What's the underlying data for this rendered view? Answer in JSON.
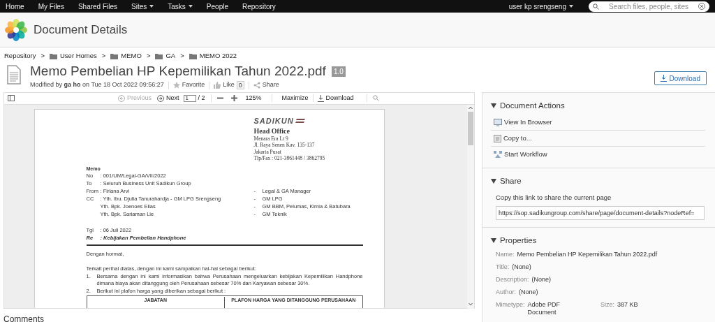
{
  "nav": {
    "items": [
      {
        "label": "Home",
        "dropdown": false
      },
      {
        "label": "My Files",
        "dropdown": false
      },
      {
        "label": "Shared Files",
        "dropdown": false
      },
      {
        "label": "Sites",
        "dropdown": true
      },
      {
        "label": "Tasks",
        "dropdown": true
      },
      {
        "label": "People",
        "dropdown": false
      },
      {
        "label": "Repository",
        "dropdown": false
      }
    ],
    "user": "user kp srengseng",
    "search": {
      "placeholder": "Search files, people, sites"
    }
  },
  "header": {
    "title": "Document Details"
  },
  "breadcrumb": [
    {
      "label": "Repository",
      "kind": "root"
    },
    {
      "label": "User Homes",
      "kind": "folder"
    },
    {
      "label": "MEMO",
      "kind": "folder"
    },
    {
      "label": "GA",
      "kind": "folder"
    },
    {
      "label": "MEMO 2022",
      "kind": "folder"
    }
  ],
  "breadcrumb_separator": ">",
  "document": {
    "title": "Memo Pembelian HP Kepemilikan Tahun 2022.pdf",
    "version": "1.0",
    "modified_prefix": "Modified by",
    "modifier": "ga ho",
    "modified_date": "on Tue 18 Oct 2022 09:56:27",
    "favorite": "Favorite",
    "like": "Like",
    "like_count": "0",
    "share": "Share",
    "download": "Download"
  },
  "viewer": {
    "previous": {
      "label": "Previous",
      "disabled": true
    },
    "next": {
      "label": "Next",
      "disabled": false
    },
    "page": "1",
    "page_total": "/ 2",
    "zoom": "125%",
    "maximize": "Maximize",
    "download": "Download"
  },
  "pdf": {
    "company": "SADIKUN",
    "office_title": "Head Office",
    "office_lines": [
      "Menara Era Lt 9",
      "Jl. Raya Senen Kav. 135-137",
      "Jakarta Pusat",
      "Tlp/Fax : 021-3861448 / 3862795"
    ],
    "memo_label": "Memo",
    "fields": [
      {
        "label": "No",
        "lines": [
          {
            "text": ": 001/UM/Legal-GA/VII/2022"
          }
        ]
      },
      {
        "label": "To",
        "lines": [
          {
            "text": ": Seluruh Business Unit Sadikun Group"
          }
        ]
      },
      {
        "label": "From",
        "lines": [
          {
            "text": ": Firlana Arvi",
            "dash": "-",
            "role": "Legal & GA Manager"
          }
        ]
      },
      {
        "label": "CC",
        "lines": [
          {
            "text": ": Yth. Ibu. Djulia Tanurahardja - GM LPG Srengseng",
            "dash": "-",
            "role": "GM LPG"
          },
          {
            "text": "Yth. Bpk. Joenoes Elias",
            "dash": "-",
            "role": "GM BBM, Pelumas, Kimia & Batubara"
          },
          {
            "text": "Yth. Bpk. Sariaman Lie",
            "dash": "-",
            "role": "GM Teknik"
          }
        ]
      }
    ],
    "dated_fields": [
      {
        "label": "Tgl",
        "text": ": 06 Juli 2022",
        "emphasis": false
      },
      {
        "label": "Re",
        "text": ": Kebijakan Pembelian Handphone",
        "emphasis": true
      }
    ],
    "greeting": "Dengan hormat,",
    "intro": "Terkait perihal diatas, dengan ini kami sampaikan hal-hal sebagai berikut:",
    "items": [
      {
        "number": "1.",
        "text": "Bersama dengan ini kami informasikan bahwa Perusahaan mengeluarkan kebijakan Kepemilikan Handphone dimana biaya akan ditanggung oleh Perusahaan sebesar 70% dan Karyawan sebesar 30%."
      },
      {
        "number": "2.",
        "text": "Berikut ini plafon harga yang diberikan sebagai berikut :"
      }
    ],
    "table_headers": [
      "JABATAN",
      "PLAFON HARGA YANG DITANGGUNG PERUSAHAAN"
    ]
  },
  "comments": "Comments",
  "panel": {
    "actions": {
      "title": "Document Actions",
      "expanded": true,
      "items": [
        {
          "label": "View In Browser",
          "kind": "browser"
        },
        {
          "label": "Copy to...",
          "kind": "copy"
        },
        {
          "label": "Start Workflow",
          "kind": "workflow"
        }
      ]
    },
    "share": {
      "title": "Share",
      "expanded": true,
      "text": "Copy this link to share the current page",
      "link": "https://sop.sadikungroup.com/share/page/document-details?nodeRef="
    },
    "properties": {
      "title": "Properties",
      "expanded": true,
      "rows": [
        {
          "label": "Name:",
          "value": "Memo Pembelian HP Kepemilikan Tahun 2022.pdf"
        },
        {
          "label": "Title:",
          "value": "(None)"
        },
        {
          "label": "Description:",
          "value": "(None)"
        },
        {
          "label": "Author:",
          "value": "(None)"
        }
      ],
      "mimetype": {
        "label": "Mimetype:",
        "value": "Adobe PDF Document"
      },
      "size": {
        "label": "Size:",
        "value": "387 KB"
      }
    }
  }
}
